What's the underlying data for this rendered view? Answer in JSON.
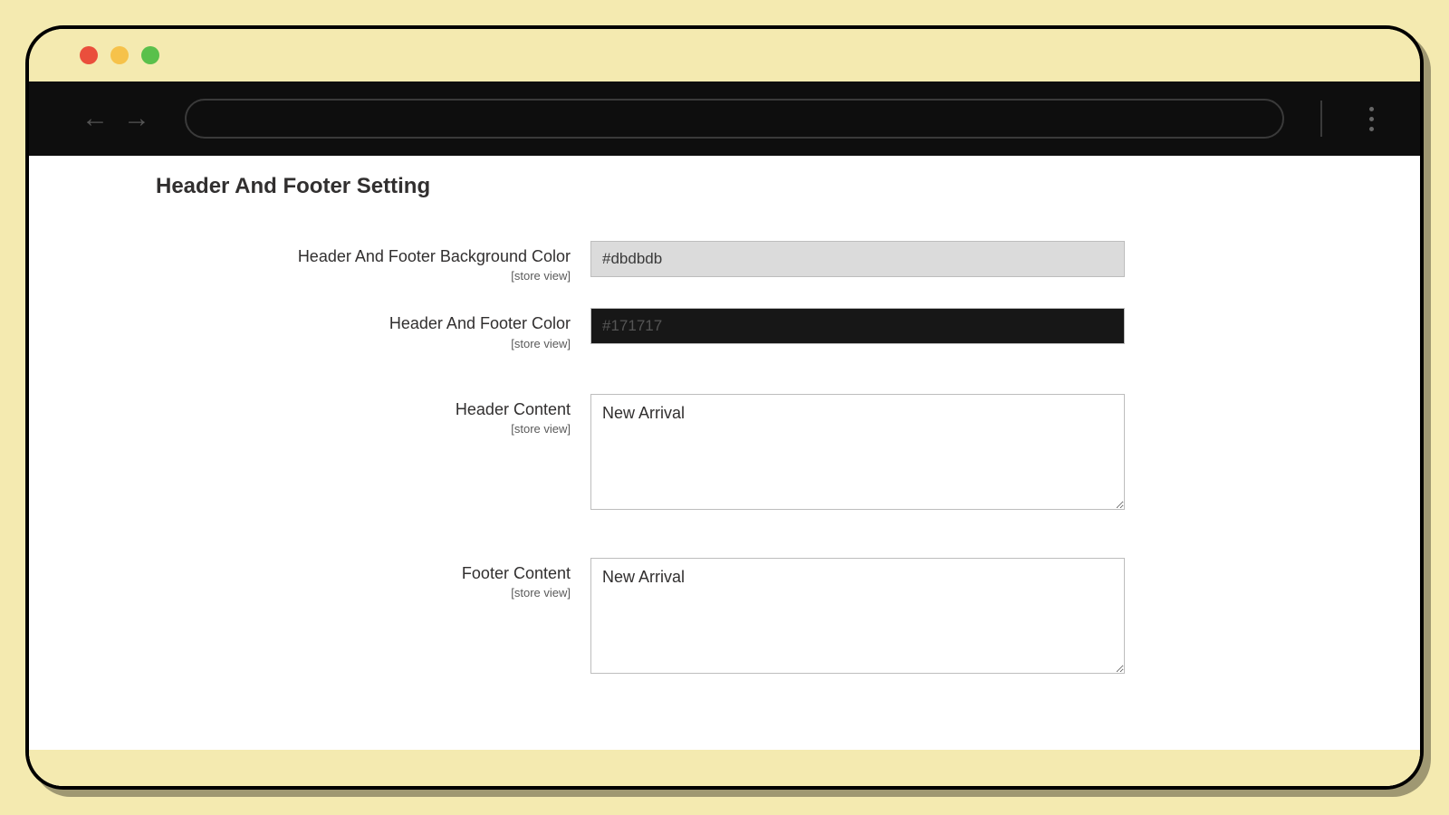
{
  "section": {
    "title": "Header And Footer Setting"
  },
  "fields": {
    "bgcolor": {
      "label": "Header And Footer Background Color",
      "scope": "[store view]",
      "value": "#dbdbdb"
    },
    "color": {
      "label": "Header And Footer Color",
      "scope": "[store view]",
      "value": "#171717"
    },
    "headerContent": {
      "label": "Header Content",
      "scope": "[store view]",
      "value": "New Arrival"
    },
    "footerContent": {
      "label": "Footer Content",
      "scope": "[store view]",
      "value": "New Arrival"
    }
  },
  "colors": {
    "bgcolor_swatch": "#dbdbdb",
    "color_swatch": "#171717",
    "swatch_text_light": "#3a3a3a",
    "swatch_text_dark": "#555"
  }
}
